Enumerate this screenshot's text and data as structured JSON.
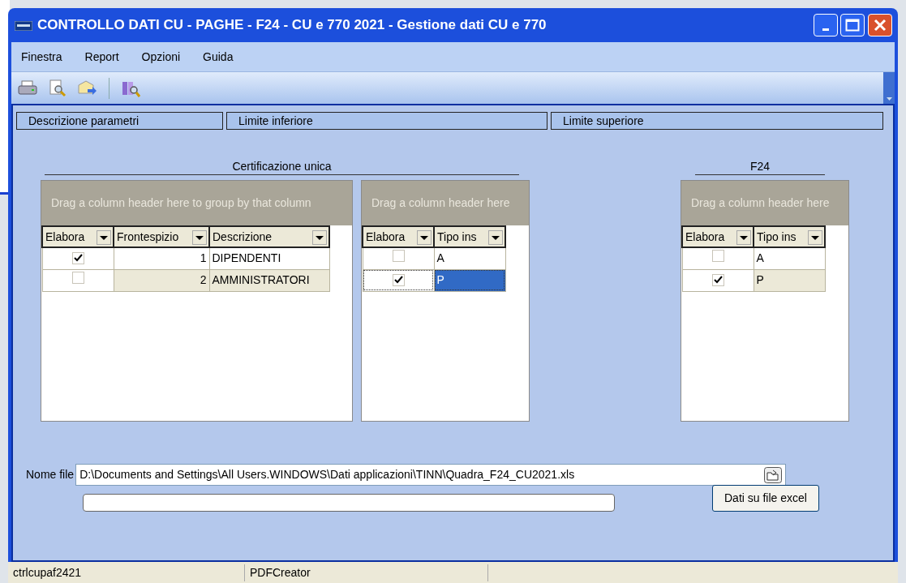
{
  "window": {
    "title": "CONTROLLO DATI CU - PAGHE - F24 - CU e 770 2021 - Gestione dati CU e 770"
  },
  "menu": [
    "Finestra",
    "Report",
    "Opzioni",
    "Guida"
  ],
  "parameters_header": [
    "Descrizione parametri",
    "Limite inferiore",
    "Limite superiore"
  ],
  "grids": [
    {
      "title": "Certificazione unica",
      "group_hint": "Drag a column header here to group by that column",
      "columns": [
        {
          "label": "Elabora",
          "kind": "check"
        },
        {
          "label": "Frontespizio",
          "kind": "number"
        },
        {
          "label": "Descrizione",
          "kind": "text"
        }
      ],
      "rows": [
        {
          "selected": false,
          "cells": [
            {
              "checked": true
            },
            "1",
            "DIPENDENTI"
          ]
        },
        {
          "selected": false,
          "cells": [
            {
              "checked": false
            },
            "2",
            "AMMINISTRATORI"
          ]
        }
      ]
    },
    {
      "group_hint": "Drag a column header here",
      "columns": [
        {
          "label": "Elabora",
          "kind": "check"
        },
        {
          "label": "Tipo ins",
          "kind": "text"
        }
      ],
      "rows": [
        {
          "selected": false,
          "cells": [
            {
              "checked": false
            },
            "A"
          ]
        },
        {
          "selected": true,
          "cells": [
            {
              "checked": true
            },
            "P"
          ]
        }
      ]
    },
    {
      "title": "F24",
      "group_hint": "Drag a column header here",
      "columns": [
        {
          "label": "Elabora",
          "kind": "check"
        },
        {
          "label": "Tipo ins",
          "kind": "text"
        }
      ],
      "rows": [
        {
          "selected": false,
          "cells": [
            {
              "checked": false
            },
            "A"
          ]
        },
        {
          "selected": false,
          "cells": [
            {
              "checked": true
            },
            "P"
          ]
        }
      ]
    }
  ],
  "file": {
    "label": "Nome file",
    "value": "D:\\Documents and Settings\\All Users.WINDOWS\\Dati applicazioni\\TINN\\Quadra_F24_CU2021.xls"
  },
  "progress": {
    "level": 0
  },
  "export_button": "Dati su file excel",
  "status_bar": [
    "ctrlcupaf2421",
    "PDFCreator"
  ]
}
